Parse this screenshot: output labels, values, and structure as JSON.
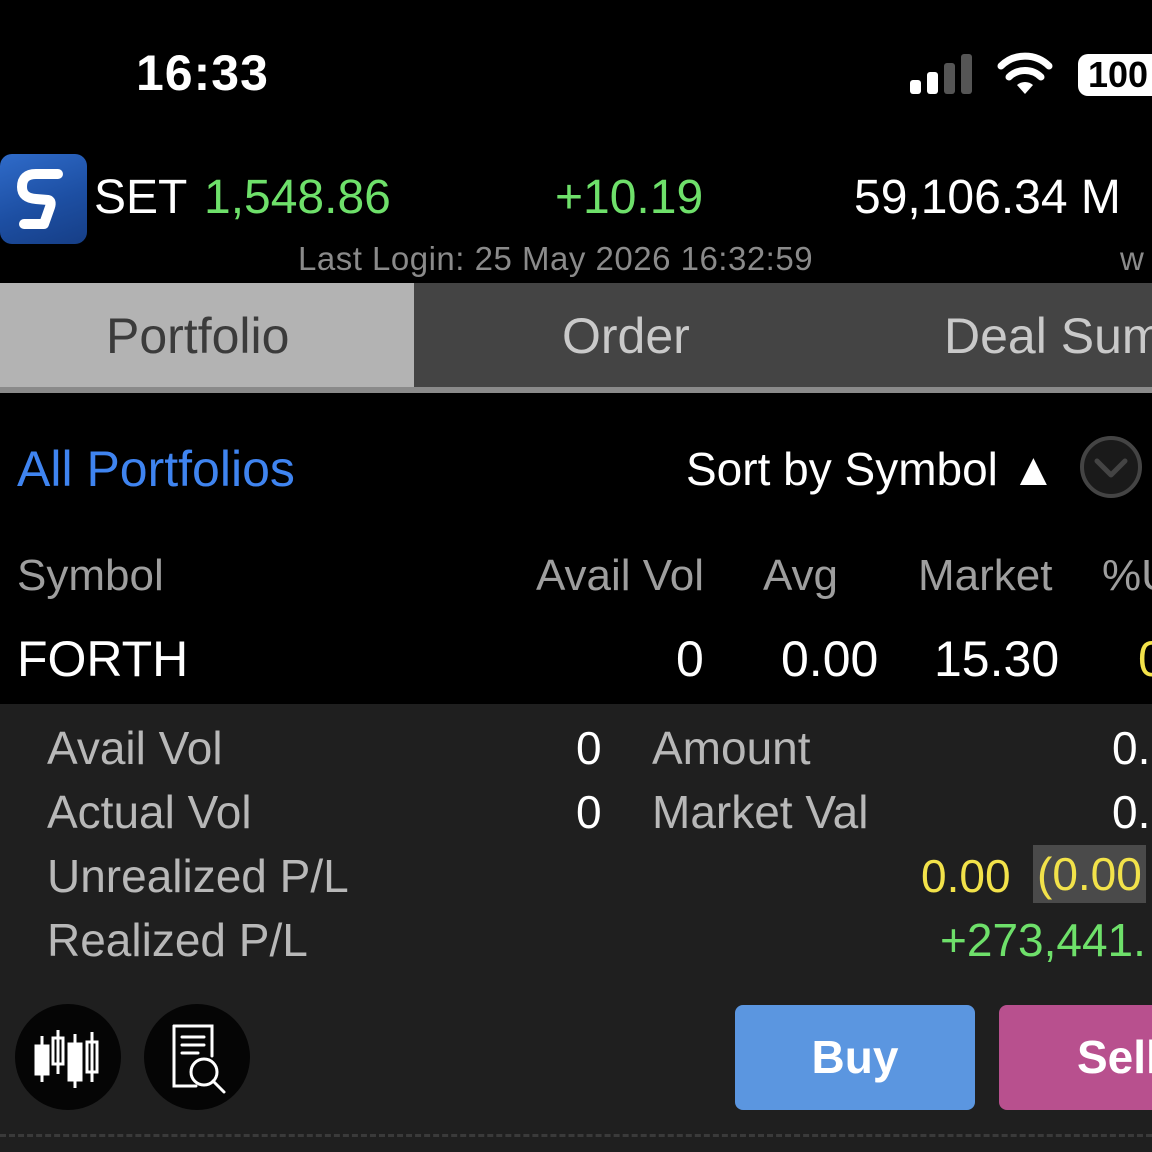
{
  "status_bar": {
    "time": "16:33",
    "battery": "100"
  },
  "index": {
    "name": "SET",
    "value": "1,548.86",
    "change": "+10.19",
    "volume": "59,106.34 M",
    "last_login": "Last Login: 25 May 2026 16:32:59",
    "login_tail": "w"
  },
  "tabs": [
    {
      "label": "Portfolio",
      "active": true
    },
    {
      "label": "Order",
      "active": false
    },
    {
      "label": "Deal Sum",
      "active": false
    }
  ],
  "filter": {
    "portfolio": "All Portfolios",
    "sort": "Sort by Symbol ▲"
  },
  "table": {
    "headers": [
      "Symbol",
      "Avail Vol",
      "Avg",
      "Market",
      "%U"
    ],
    "row": {
      "symbol": "FORTH",
      "avail_vol": "0",
      "avg": "0.00",
      "market": "15.30",
      "pct": "0"
    }
  },
  "detail": {
    "avail_vol_label": "Avail Vol",
    "avail_vol": "0",
    "actual_vol_label": "Actual Vol",
    "actual_vol": "0",
    "amount_label": "Amount",
    "amount": "0.",
    "market_val_label": "Market Val",
    "market_val": "0.",
    "unrealized_label": "Unrealized P/L",
    "unrealized": "0.00",
    "unrealized_pct": "(0.00",
    "realized_label": "Realized P/L",
    "realized": "+273,441."
  },
  "actions": {
    "buy": "Buy",
    "sell": "Sell"
  },
  "colors": {
    "positive": "#6ee06a",
    "neutral": "#f2e24a",
    "link": "#3f84f0",
    "buy": "#5b96e0",
    "sell": "#b8508e"
  }
}
